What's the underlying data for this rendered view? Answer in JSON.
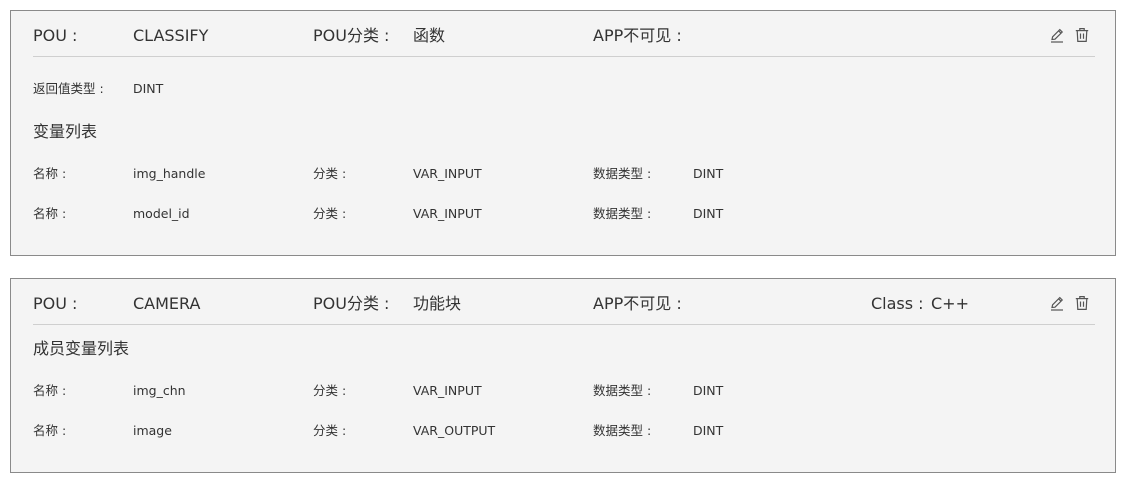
{
  "cards": [
    {
      "pou_label": "POU :",
      "pou_name": "CLASSIFY",
      "category_label": "POU分类 :",
      "category_value": "函数",
      "app_invisible_label": "APP不可见 :",
      "return_type_label": "返回值类型 :",
      "return_type_value": "DINT",
      "section_title": "变量列表",
      "variables": [
        {
          "name_label": "名称 :",
          "name": "img_handle",
          "class_label": "分类 :",
          "class": "VAR_INPUT",
          "type_label": "数据类型 :",
          "type": "DINT"
        },
        {
          "name_label": "名称 :",
          "name": "model_id",
          "class_label": "分类 :",
          "class": "VAR_INPUT",
          "type_label": "数据类型 :",
          "type": "DINT"
        }
      ],
      "icons": {
        "edit": "pencil-icon",
        "delete": "trash-icon"
      }
    },
    {
      "pou_label": "POU :",
      "pou_name": "CAMERA",
      "category_label": "POU分类 :",
      "category_value": "功能块",
      "app_invisible_label": "APP不可见 :",
      "class_label": "Class :",
      "class_value": "C++",
      "section_title": "成员变量列表",
      "variables": [
        {
          "name_label": "名称 :",
          "name": "img_chn",
          "class_label": "分类 :",
          "class": "VAR_INPUT",
          "type_label": "数据类型 :",
          "type": "DINT"
        },
        {
          "name_label": "名称 :",
          "name": "image",
          "class_label": "分类 :",
          "class": "VAR_OUTPUT",
          "type_label": "数据类型 :",
          "type": "DINT"
        }
      ],
      "icons": {
        "edit": "pencil-icon",
        "delete": "trash-icon"
      }
    }
  ],
  "colors": {
    "card_background": "#f4f4f4",
    "card_border": "#8a8a8a",
    "divider": "#cfcfcf",
    "text": "#333333"
  }
}
